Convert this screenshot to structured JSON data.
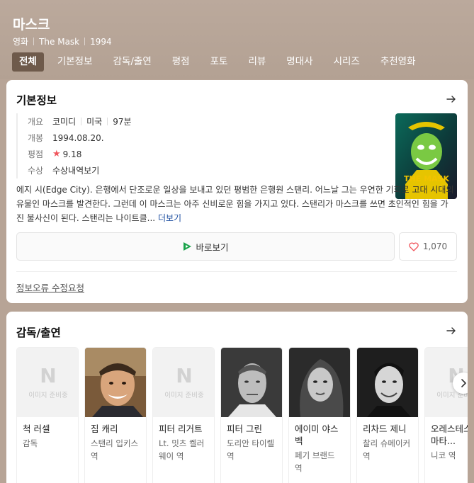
{
  "header": {
    "title": "마스크",
    "category": "영화",
    "original_title": "The Mask",
    "year": "1994"
  },
  "tabs": [
    {
      "label": "전체",
      "active": true
    },
    {
      "label": "기본정보"
    },
    {
      "label": "감독/출연"
    },
    {
      "label": "평점"
    },
    {
      "label": "포토"
    },
    {
      "label": "리뷰"
    },
    {
      "label": "명대사"
    },
    {
      "label": "시리즈"
    },
    {
      "label": "추천영화"
    }
  ],
  "basic_info": {
    "section_title": "기본정보",
    "overview_label": "개요",
    "genre": "코미디",
    "country": "미국",
    "runtime": "97분",
    "release_label": "개봉",
    "release_date": "1994.08.20.",
    "rating_label": "평점",
    "rating": "9.18",
    "awards_label": "수상",
    "awards_link": "수상내역보기",
    "synopsis": "에지 시(Edge City). 은행에서 단조로운 일상을 보내고 있던 평범한 은행원 스탠리. 어느날 그는 우연한 기회로 고대 시대의 유물인 마스크를 발견한다. 그런데 이 마스크는 아주 신비로운 힘을 가지고 있다. 스탠리가 마스크를 쓰면 초인적인 힘을 가진 불사신이 된다. 스탠리는 나이트클...",
    "more_label": "더보기",
    "watch_label": "바로보기",
    "like_count": "1,070",
    "report_label": "정보오류 수정요청",
    "poster_text": "THE MASK"
  },
  "cast": {
    "section_title": "감독/출연",
    "placeholder_letter": "N",
    "placeholder_text": "이미지 준비중",
    "people": [
      {
        "name": "척 러셀",
        "role": "감독",
        "photo": "placeholder"
      },
      {
        "name": "짐 캐리",
        "role": "스탠리 입키스 역",
        "photo": "photo"
      },
      {
        "name": "피터 리거트",
        "role": "Lt. 밋츠 켈러웨이 역",
        "photo": "placeholder"
      },
      {
        "name": "피터 그린",
        "role": "도리안 타이렐 역",
        "photo": "photo"
      },
      {
        "name": "에이미 야스벡",
        "role": "페기 브랜드 역",
        "photo": "photo"
      },
      {
        "name": "리차드 제니",
        "role": "찰리 슈메이커 역",
        "photo": "photo"
      },
      {
        "name": "오레스테스 마타...",
        "role": "니코 역",
        "photo": "placeholder"
      }
    ]
  },
  "colors": {
    "header_bg": "#b7a496",
    "active_tab": "#6e5a4b",
    "link": "#1d4ea0",
    "star": "#f0555c"
  }
}
